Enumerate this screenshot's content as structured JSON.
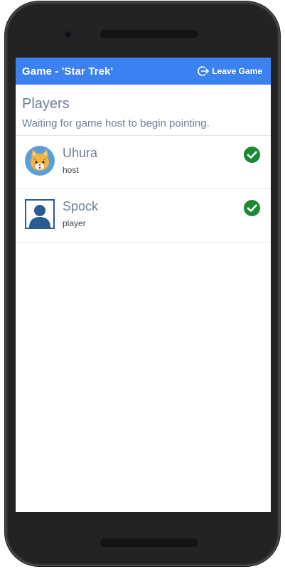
{
  "appbar": {
    "title": "Game - 'Star Trek'",
    "leave_label": "Leave Game"
  },
  "players_section": {
    "title": "Players",
    "status": "Waiting for game host to begin pointing."
  },
  "players": [
    {
      "name": "Uhura",
      "role": "host",
      "avatar": "cat-avatar-icon",
      "ready": true
    },
    {
      "name": "Spock",
      "role": "player",
      "avatar": "person-avatar-icon",
      "ready": true
    }
  ],
  "colors": {
    "appbar": "#3b82f0",
    "text_muted": "#6e8099",
    "check_green": "#1a8a35",
    "avatar_blue": "#2b5b92",
    "cat_bg": "#5aa0d8",
    "cat_fur": "#f2b245"
  }
}
